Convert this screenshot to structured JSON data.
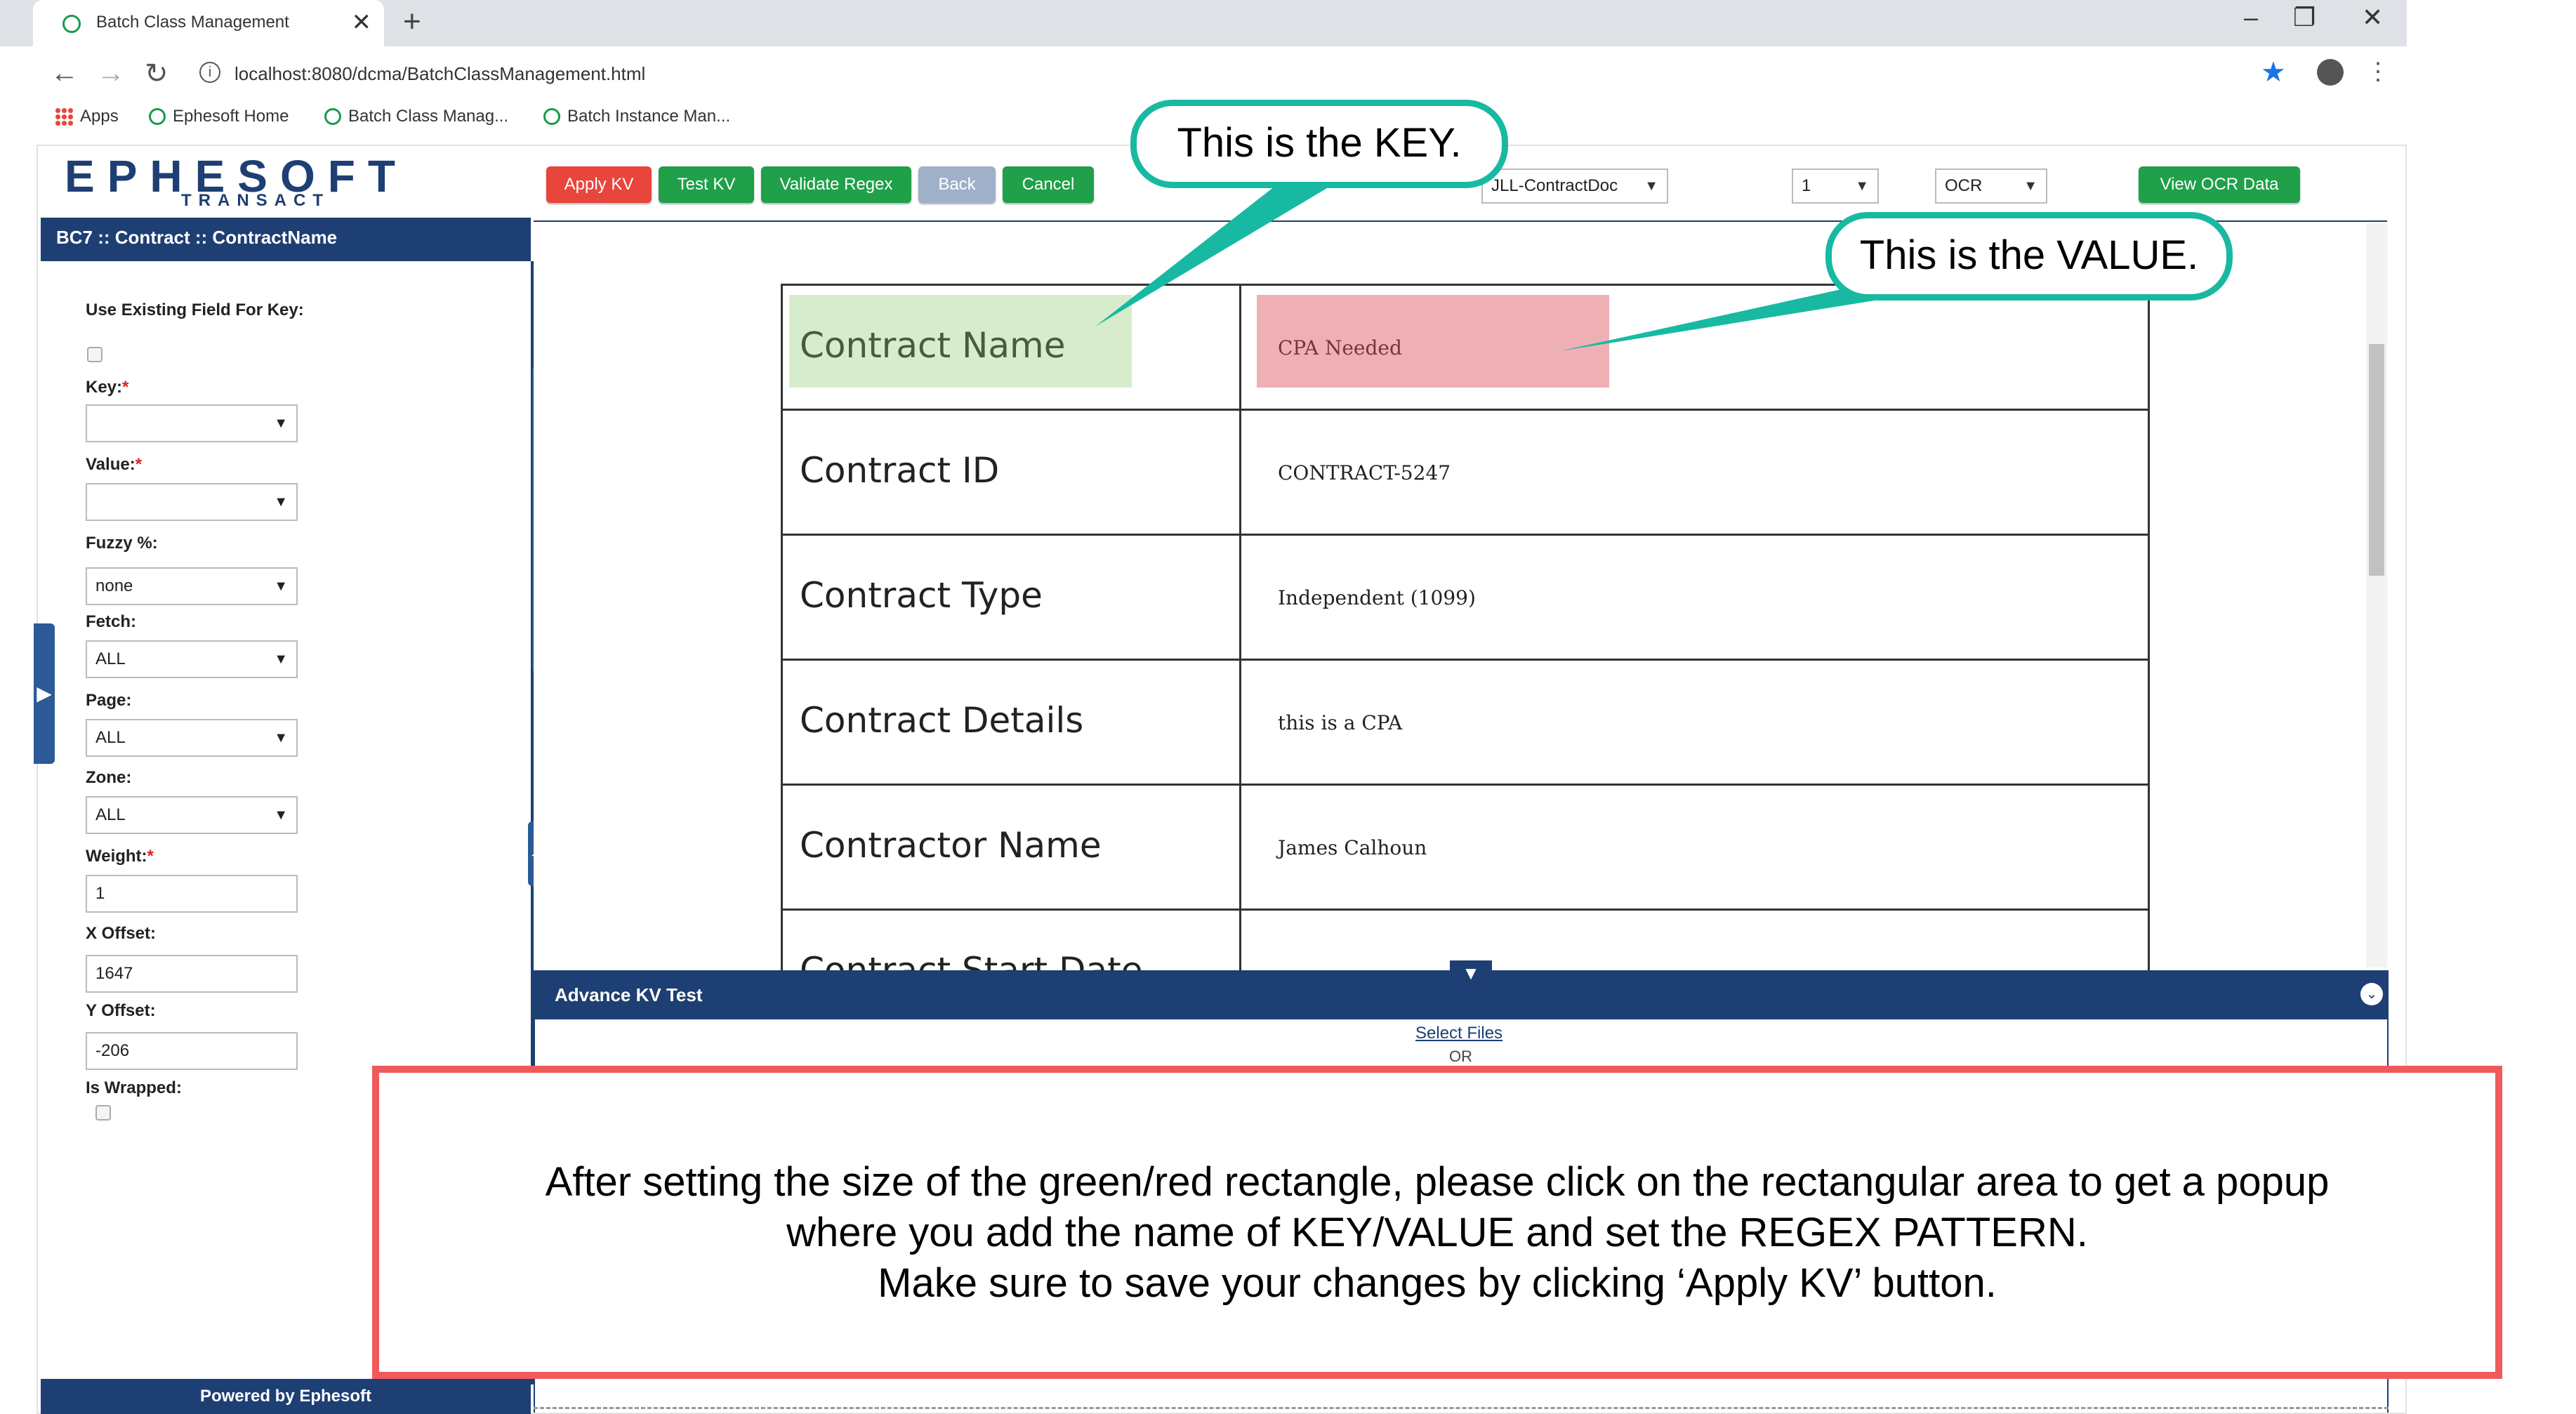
{
  "browser": {
    "tab_title": "Batch Class Management",
    "tab_close": "✕",
    "new_tab": "+",
    "url": "localhost:8080/dcma/BatchClassManagement.html",
    "window_controls": {
      "minimize": "–",
      "restore": "❐",
      "close": "✕"
    },
    "bookmarks": [
      {
        "label": "Apps"
      },
      {
        "label": "Ephesoft Home"
      },
      {
        "label": "Batch Class Manag..."
      },
      {
        "label": "Batch Instance Man..."
      }
    ]
  },
  "header": {
    "logo_text": "EPHESOFT",
    "logo_sub": "TRANSACT",
    "buttons": {
      "apply_kv": "Apply KV",
      "test_kv": "Test KV",
      "validate_regex": "Validate Regex",
      "back": "Back",
      "cancel": "Cancel",
      "view_ocr": "View OCR Data"
    },
    "doc_select": "JLL-ContractDoc",
    "page_select": "1",
    "mode_select": "OCR",
    "colors": {
      "red": "#e8453c",
      "green": "#1fa049",
      "gray": "#9fb0c8",
      "navy": "#1e3f73"
    }
  },
  "left_panel": {
    "title": "BC7 :: Contract :: ContractName",
    "use_existing_label": "Use Existing Field For Key:",
    "key_label": "Key:",
    "value_label": "Value:",
    "fuzzy_label": "Fuzzy %:",
    "fuzzy_value": "none",
    "fetch_label": "Fetch:",
    "fetch_value": "ALL",
    "page_label": "Page:",
    "page_value": "ALL",
    "zone_label": "Zone:",
    "zone_value": "ALL",
    "weight_label": "Weight:",
    "weight_value": "1",
    "xoffset_label": "X Offset:",
    "xoffset_value": "1647",
    "yoffset_label": "Y Offset:",
    "yoffset_value": "-206",
    "wrapped_label": "Is Wrapped:",
    "required_mark": "*",
    "footer": "Powered by Ephesoft"
  },
  "document": {
    "rows": [
      {
        "key": "Contract Name",
        "value": "CPA Needed"
      },
      {
        "key": "Contract ID",
        "value": "CONTRACT-5247"
      },
      {
        "key": "Contract Type",
        "value": "Independent (1099)"
      },
      {
        "key": "Contract Details",
        "value": "this is a CPA"
      },
      {
        "key": "Contractor Name",
        "value": "James Calhoun"
      },
      {
        "key": "Contract Start Date",
        "value": ""
      }
    ]
  },
  "advanced_kv": {
    "title": "Advance KV Test",
    "select_files": "Select Files",
    "or": "OR"
  },
  "annotations": {
    "key_callout": "This is the KEY.",
    "value_callout": "This is the VALUE.",
    "note_lines": [
      "After setting the size of the green/red rectangle, please click on the rectangular area to get a popup",
      "where you add the name of KEY/VALUE and set the REGEX PATTERN.",
      "Make sure to save your changes by clicking ‘Apply KV’ button."
    ],
    "callout_color": "#18b9a2",
    "note_border_color": "#f15a5a"
  }
}
